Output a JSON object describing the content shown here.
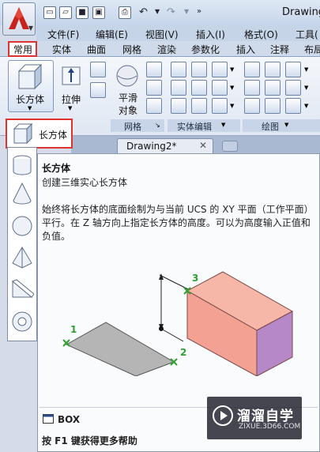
{
  "window": {
    "title": "Drawing"
  },
  "menu": [
    "文件(F)",
    "编辑(E)",
    "视图(V)",
    "插入(I)",
    "格式(O)",
    "工具("
  ],
  "ribbon_tabs": [
    "常用",
    "实体",
    "曲面",
    "网格",
    "渲染",
    "参数化",
    "插入",
    "注释",
    "布局"
  ],
  "ribbon": {
    "box_label": "长方体",
    "extrude_label": "拉伸",
    "smooth_label_1": "平滑",
    "smooth_label_2": "对象",
    "panels": [
      "网格",
      "实体编辑",
      "绘图"
    ]
  },
  "command_button": {
    "label": "长方体"
  },
  "document_tab": {
    "label": "Drawing2*"
  },
  "tooltip": {
    "title": "长方体",
    "subtitle": "创建三维实心长方体",
    "description": "始终将长方体的底面绘制为与当前 UCS 的 XY 平面（工作平面）平行。在 Z 轴方向上指定长方体的高度。可以为高度输入正值和负值。",
    "command": "BOX",
    "help": "按 F1 键获得更多帮助",
    "labels": [
      "1",
      "2",
      "3"
    ]
  },
  "watermark": {
    "text": "溜溜自学",
    "sub": "ZIXUE.3D66.COM"
  },
  "colors": {
    "accent": "#e0322e",
    "box_face": "#f2a193",
    "box_side": "#b788c7",
    "plane": "#b5b5b5",
    "marker": "#2ea12e"
  }
}
